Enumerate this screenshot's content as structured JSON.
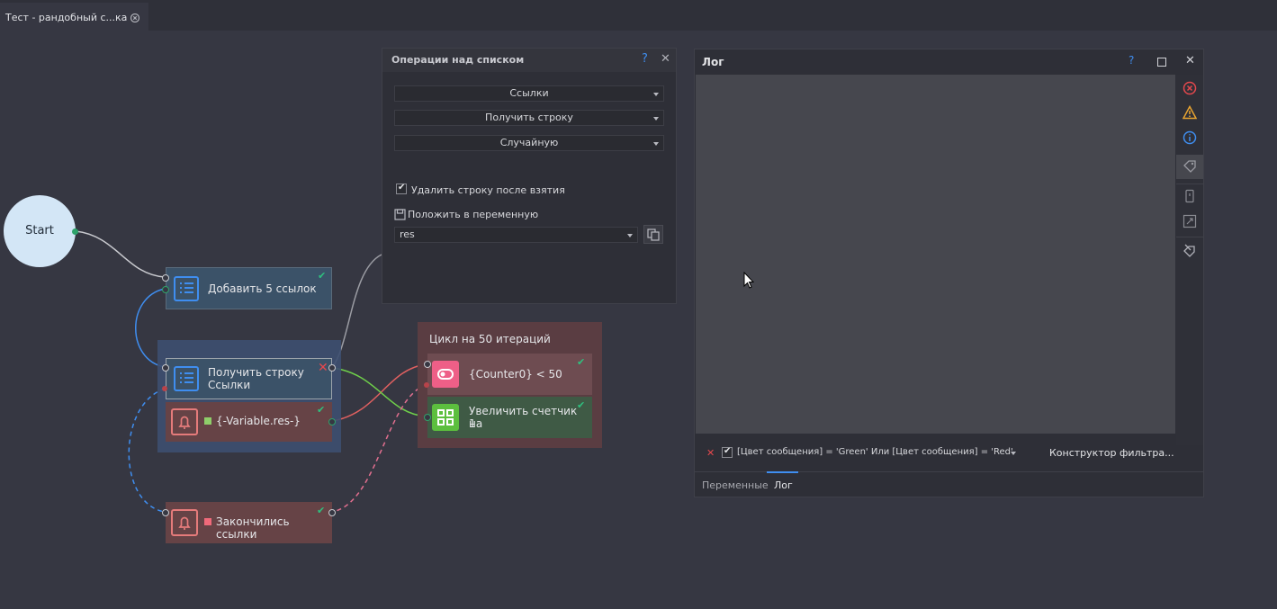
{
  "tab": {
    "title": "Тест - рандобный с...ка"
  },
  "canvas": {
    "start": "Start",
    "node_add": "Добавить 5 ссылок",
    "node_get_line1": "Получить строку",
    "node_get_line2": "Ссылки",
    "node_var": "{-Variable.res-}",
    "node_end": "Закончились ссылки",
    "loop_title": "Цикл на 50 итераций",
    "node_counter": "{Counter0} < 50",
    "node_inc_line1": "Увеличить счетчик на",
    "node_inc_line2": "1"
  },
  "ops_panel": {
    "title": "Операции над списком",
    "help": "?",
    "dropdown1": "Ссылки",
    "dropdown2": "Получить строку",
    "dropdown3": "Случайную",
    "checkbox_label": "Удалить строку после взятия",
    "checkbox_checked": true,
    "save_label": "Положить в переменную",
    "var_value": "res"
  },
  "log_panel": {
    "title": "Лог",
    "help": "?",
    "filter": "[Цвет сообщения] = 'Green' Или [Цвет сообщения] = 'Red'",
    "filter_constructor": "Конструктор фильтра...",
    "tab_vars": "Переменные",
    "tab_log": "Лог"
  },
  "colors": {
    "accent": "#3f8ef0",
    "green_check": "#2fc07f",
    "red": "#e5484d"
  }
}
